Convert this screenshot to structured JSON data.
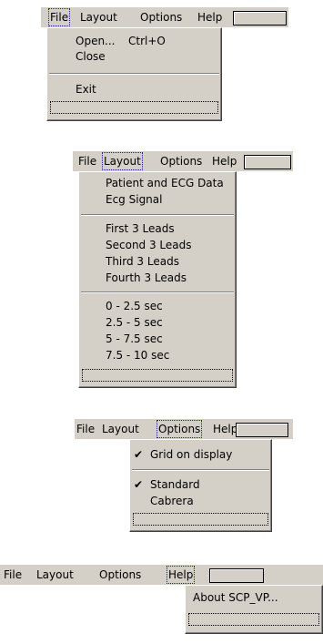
{
  "panel1": {
    "menu": [
      "File",
      "Layout",
      "Options",
      "Help"
    ],
    "items": [
      {
        "label": "Open...",
        "shortcut": "Ctrl+O"
      },
      {
        "label": "Close"
      },
      {
        "label": "Exit"
      }
    ]
  },
  "panel2": {
    "menu": [
      "File",
      "Layout",
      "Options",
      "Help"
    ],
    "items": [
      {
        "label": "Patient and ECG Data"
      },
      {
        "label": "Ecg Signal"
      },
      {
        "label": "First 3 Leads"
      },
      {
        "label": "Second 3 Leads"
      },
      {
        "label": "Third 3 Leads"
      },
      {
        "label": "Fourth 3 Leads"
      },
      {
        "label": "0 - 2.5 sec"
      },
      {
        "label": "2.5 - 5 sec"
      },
      {
        "label": "5 - 7.5 sec"
      },
      {
        "label": "7.5 - 10 sec"
      }
    ]
  },
  "panel3": {
    "menu": [
      "File",
      "Layout",
      "Options",
      "Help"
    ],
    "items": [
      {
        "label": "Grid on display",
        "checked": true
      },
      {
        "label": "Standard",
        "checked": true
      },
      {
        "label": "Cabrera",
        "checked": false
      }
    ]
  },
  "panel4": {
    "menu": [
      "File",
      "Layout",
      "Options",
      "Help"
    ],
    "items": [
      {
        "label": "About SCP_VP..."
      }
    ]
  },
  "colors": {
    "menu_bg": "#d4d0c8",
    "focus_dots": "#1c2a6a"
  }
}
